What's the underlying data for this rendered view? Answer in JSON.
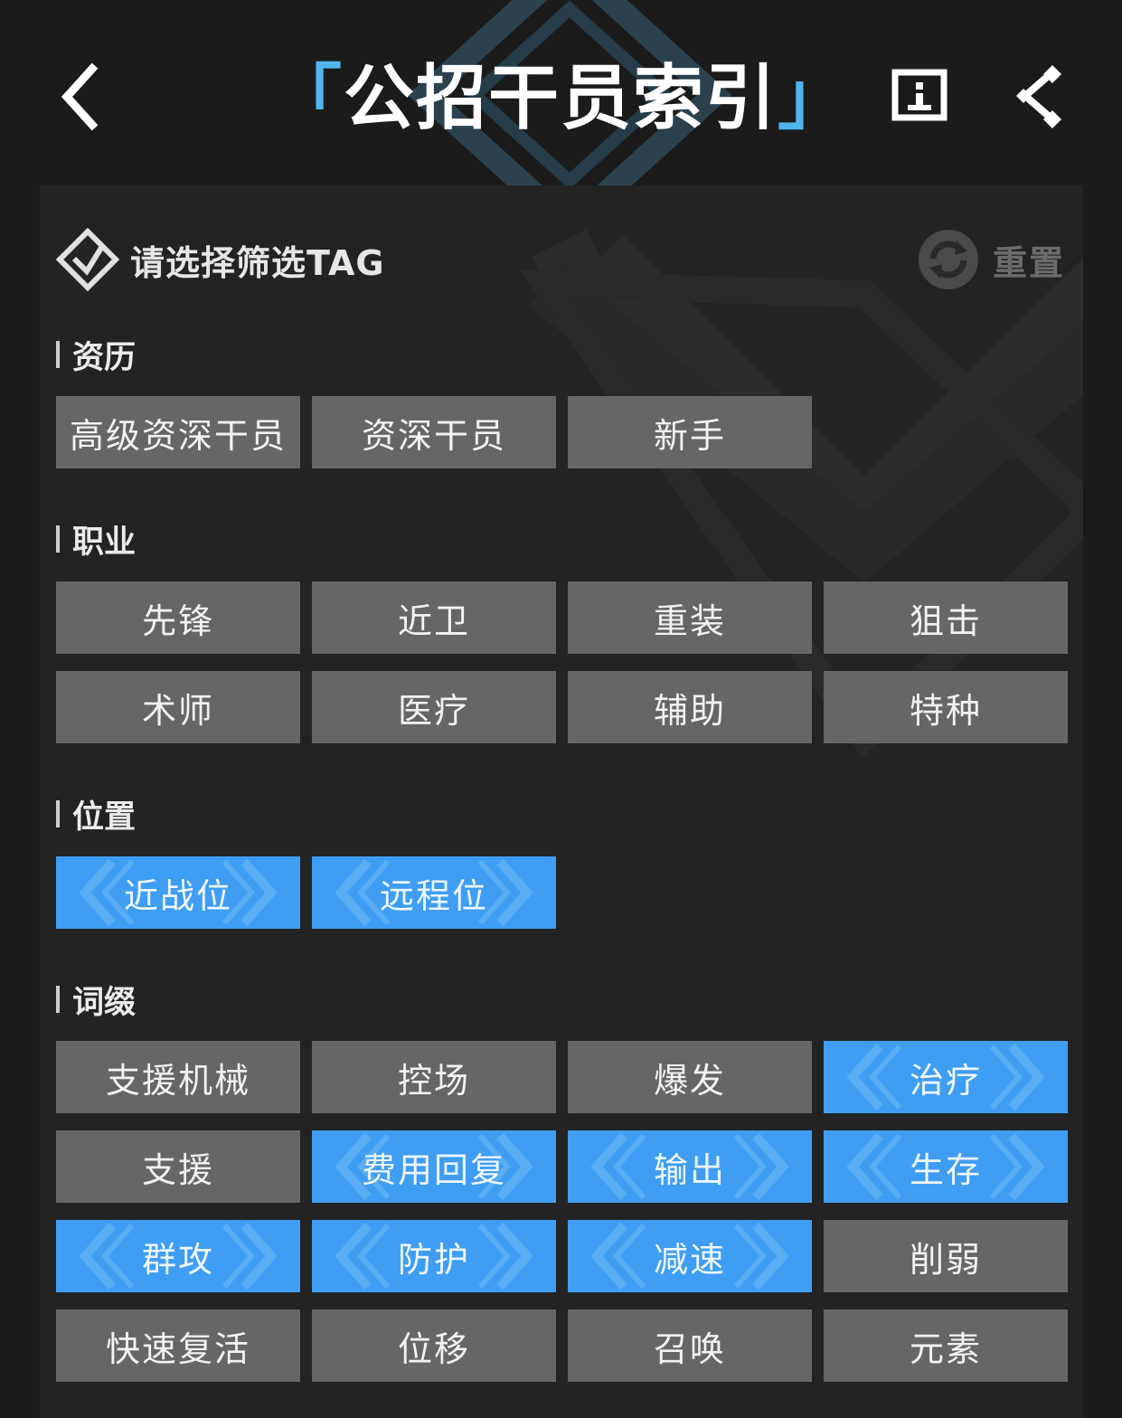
{
  "header": {
    "title_open": "「",
    "title": "公招干员索引",
    "title_close": "」"
  },
  "icons": {
    "back": "chevron-left-icon",
    "info": "info-icon",
    "share": "share-icon",
    "filter": "diamond-check-icon",
    "reset": "refresh-icon"
  },
  "colors": {
    "background": "#1b1b1b",
    "panel": "#232323",
    "tag_default": "#666666",
    "tag_selected": "#3f9ef3",
    "title_bracket": "#4fb6ee"
  },
  "filter": {
    "title": "请选择筛选TAG",
    "reset_label": "重置"
  },
  "sections": {
    "seniority": {
      "label": "资历",
      "tags": [
        {
          "label": "高级资深干员",
          "selected": false
        },
        {
          "label": "资深干员",
          "selected": false
        },
        {
          "label": "新手",
          "selected": false
        }
      ]
    },
    "profession": {
      "label": "职业",
      "tags": [
        {
          "label": "先锋",
          "selected": false
        },
        {
          "label": "近卫",
          "selected": false
        },
        {
          "label": "重装",
          "selected": false
        },
        {
          "label": "狙击",
          "selected": false
        },
        {
          "label": "术师",
          "selected": false
        },
        {
          "label": "医疗",
          "selected": false
        },
        {
          "label": "辅助",
          "selected": false
        },
        {
          "label": "特种",
          "selected": false
        }
      ]
    },
    "position": {
      "label": "位置",
      "tags": [
        {
          "label": "近战位",
          "selected": true
        },
        {
          "label": "远程位",
          "selected": true
        }
      ]
    },
    "affix": {
      "label": "词缀",
      "tags": [
        {
          "label": "支援机械",
          "selected": false
        },
        {
          "label": "控场",
          "selected": false
        },
        {
          "label": "爆发",
          "selected": false
        },
        {
          "label": "治疗",
          "selected": true
        },
        {
          "label": "支援",
          "selected": false
        },
        {
          "label": "费用回复",
          "selected": true
        },
        {
          "label": "输出",
          "selected": true
        },
        {
          "label": "生存",
          "selected": true
        },
        {
          "label": "群攻",
          "selected": true
        },
        {
          "label": "防护",
          "selected": true
        },
        {
          "label": "减速",
          "selected": true
        },
        {
          "label": "削弱",
          "selected": false
        },
        {
          "label": "快速复活",
          "selected": false
        },
        {
          "label": "位移",
          "selected": false
        },
        {
          "label": "召唤",
          "selected": false
        },
        {
          "label": "元素",
          "selected": false
        }
      ]
    }
  }
}
